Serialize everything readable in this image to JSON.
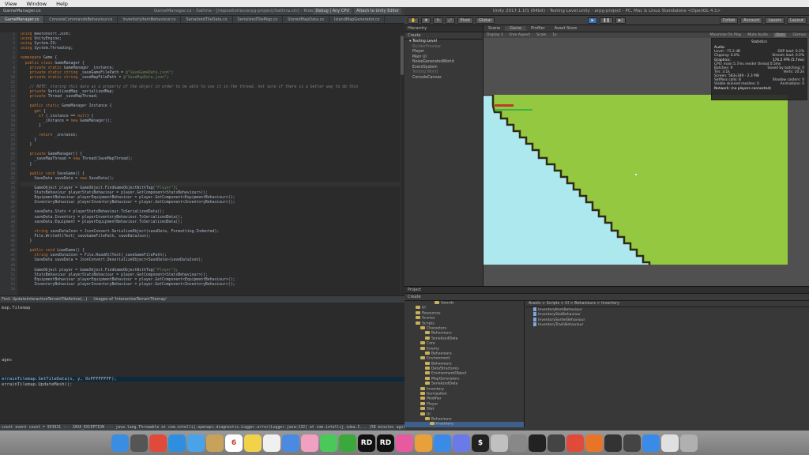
{
  "menubar": {
    "items": [
      "View",
      "Window",
      "Help"
    ]
  },
  "rider": {
    "window_title": "GameManager.cs",
    "project_title": "GameManager.cs - Xathria - [/repositories/arpg-project/Xathria.sln] - Rider 2017.2 EAP",
    "toolbar": {
      "config": "Debug | Any CPU",
      "attach": "Attach to Unity Editor"
    },
    "tabs": [
      "GameManager.cs",
      "ConsoleCommandsBehaviour.cs",
      "InventoryItemBehaviour.cs",
      "SerializedTileData.cs",
      "SerializedTileMap.cs",
      "StoredMapData.cs",
      "IslandMapGenerator.cs"
    ],
    "line_numbers": [
      "1",
      "2",
      "3",
      "4",
      "5",
      "6",
      "7",
      "8",
      "9",
      "10",
      "11",
      "12",
      "13",
      "14",
      "15",
      "16",
      "17",
      "18",
      "19",
      "20",
      "21",
      "22",
      "23",
      "24",
      "25",
      "26",
      "27",
      "28",
      "29",
      "30",
      "31",
      "32",
      "33",
      "34",
      "35",
      "36",
      "37",
      "38",
      "39",
      "40",
      "41",
      "42",
      "43",
      "44",
      "45",
      "46",
      "47",
      "48",
      "49",
      "50",
      "51",
      "52",
      "53",
      "54"
    ],
    "code": [
      "using Newtonsoft.Json;",
      "using UnityEngine;",
      "using System.IO;",
      "using System.Threading;",
      "",
      "namespace Game {",
      "  public class GameManager {",
      "    private static GameManager _instance;",
      "    private static string _saveGameFilePath = @\"SaveGameData.json\";",
      "    private static string _saveMapFilePath = @\"SaveMapData.json\";",
      "",
      "    // NOTE: storing this data as a property of the object in order to be able to use it in the thread, not sure if there is a better way to do this",
      "    private SerializedMap _serializedMap;",
      "    private Thread _saveMapThread;",
      "",
      "    public static GameManager Instance {",
      "      get {",
      "        if (_instance == null) {",
      "          _instance = new GameManager();",
      "        }",
      "",
      "        return _instance;",
      "      }",
      "    }",
      "",
      "    private GameManager() {",
      "      _saveMapThread = new Thread(SaveMapThread);",
      "    }",
      "",
      "    public void SaveGame() {",
      "      SaveData saveData = new SaveData();",
      "",
      "      GameObject player = GameObject.FindGameObjectWithTag(\"Player\");",
      "      StatsBehaviour playerStatsBehaviour = player.GetComponent<StatsBehaviour>();",
      "      EquipmentBehaviour playerEquipmentBehaviour = player.GetComponent<EquipmentBehaviour>();",
      "      InventoryBehaviour playerInventoryBehaviour = player.GetComponent<InventoryBehaviour>();",
      "",
      "      saveData.Stats = playerStatsBehaviour.ToSerializedData();",
      "      saveData.Inventory = playerInventoryBehaviour.ToSerializedData();",
      "      saveData.Equipment = playerEquipmentBehaviour.ToSerializedData();",
      "",
      "      string saveDataJson = JsonConvert.SerializeObject(saveData, Formatting.Indented);",
      "      File.WriteAllText(_saveGameFilePath, saveDataJson);",
      "    }",
      "",
      "    public void LoadGame() {",
      "      string saveDataJson = File.ReadAllText(_saveGameFilePath);",
      "      SaveData saveData = JsonConvert.DeserializeObject<SaveData>(saveDataJson);",
      "",
      "      GameObject player = GameObject.FindGameObjectWithTag(\"Player\");",
      "      StatsBehaviour playerStatsBehaviour = player.GetComponent<StatsBehaviour>();",
      "      EquipmentBehaviour playerEquipmentBehaviour = player.GetComponent<EquipmentBehaviour>();",
      "      InventoryBehaviour playerInventoryBehaviour = player.GetComponent<InventoryBehaviour>();",
      ""
    ],
    "find_bar": {
      "left": "Find: UpdateInteractiveTerrainTileActive(...)",
      "right": "Usages of 'InteractiveTerrainTilemap'"
    },
    "usages": {
      "header": "map.Tilemap",
      "group": "ages",
      "line1": "errainTilemap.SetTileData(x, y, 0xFFFFFFFF);",
      "line2": "errainTilemap.UpdateMesh();"
    },
    "status": "count event count = 953931 --- JAVA_EXCEPTION --- java.lang.Throwable at com.intellij.openapi.diagnostic.Logger.error(Logger.java:132) at com.intellij.idea.I... (58 minutes ago)    Assembly-CSharp    32:42   LF: UTF-8"
  },
  "unity": {
    "title": "Unity 2017.1.1f1 (64bit) - Testing Level.unity - arpg-project - PC, Mac & Linux Standalone <OpenGL 4.1>",
    "toolbar": {
      "pivot": "Pivot",
      "global": "Global",
      "collab": "Collab",
      "account": "Account",
      "layers": "Layers",
      "layout": "Layout"
    },
    "hierarchy": {
      "tab": "Hierarchy",
      "create": "Create",
      "scene": "Testing Level",
      "items": [
        "BuilderPreview",
        "Player",
        "Main UI",
        "NoiseGeneratedWorld",
        "EventSystem",
        "Testing World",
        "ConsoleCanvas"
      ]
    },
    "game": {
      "tabs": [
        "Scene",
        "Game",
        "Profiler",
        "Asset Store"
      ],
      "display": "Display 1",
      "aspect": "Free Aspect",
      "scale": "Scale",
      "scale_val": "1x",
      "controls": [
        "Maximize On Play",
        "Mute Audio",
        "Stats",
        "Gizmos"
      ]
    },
    "statistics": {
      "title": "Statistics",
      "audio_label": "Audio:",
      "level": "Level: -75.2 dB",
      "clipping": "Clipping: 0.0%",
      "dsp": "DSP load: 0.2%",
      "stream": "Stream load: 0.0%",
      "graphics_label": "Graphics:",
      "fps": "174.2 FPS (5.7ms)",
      "cpu": "CPU: main 5.7ms  render thread 0.5ms",
      "batches": "Batches: 9",
      "saved": "Saved by batching: 0",
      "tris": "Tris: 3.1k",
      "verts": "Verts: 10.2k",
      "screen": "Screen: 583x349 - 2.3 MB",
      "setpass": "SetPass calls: 8",
      "shadow": "Shadow casters: 0",
      "skinned": "Visible skinned meshes: 0",
      "animations": "Animations: 0",
      "network": "Network: (no players connected)"
    },
    "project": {
      "tab": "Project",
      "create": "Create",
      "breadcrumb": "Assets > Scripts > UI > Behaviours > Inventory",
      "tree": [
        "Swords",
        "UI",
        "Resources",
        "Scenes",
        "Scripts",
        "Characters",
        "Behaviours",
        "SerializedData",
        "Core",
        "Enemy",
        "Behaviours",
        "Environment",
        "Behaviours",
        "DataStructures",
        "EnvironmentObject",
        "MapGenerators",
        "SerializedData",
        "Inventory",
        "Itemization",
        "Modifier",
        "Player",
        "Stat",
        "UI",
        "Behaviours",
        "Inventory"
      ],
      "files": [
        "InventoryItemBehaviour",
        "InventorySlotBehaviour",
        "InventorySorterBehaviour",
        "InventoryTrashBehaviour"
      ]
    },
    "colors": {
      "water": "#aee8ef",
      "grass": "#93c840",
      "edge": "#2e2a14"
    }
  },
  "dock": {
    "items": [
      {
        "icon": "finder-icon",
        "color": "#3a8de0",
        "label": ""
      },
      {
        "icon": "launchpad-icon",
        "color": "#555555",
        "label": ""
      },
      {
        "icon": "chrome-icon",
        "color": "#e04a3a",
        "label": ""
      },
      {
        "icon": "safari-icon",
        "color": "#2e8fe0",
        "label": ""
      },
      {
        "icon": "mail-icon",
        "color": "#4aa3e8",
        "label": ""
      },
      {
        "icon": "notes-icon",
        "color": "#c8a25a",
        "label": ""
      },
      {
        "icon": "calendar-icon",
        "color": "#ffffff",
        "label": "6"
      },
      {
        "icon": "stickies-icon",
        "color": "#f2d24a",
        "label": ""
      },
      {
        "icon": "reminders-icon",
        "color": "#f0f0f0",
        "label": ""
      },
      {
        "icon": "keynote-icon",
        "color": "#4a8ae0",
        "label": ""
      },
      {
        "icon": "photos-icon",
        "color": "#f0a0c0",
        "label": ""
      },
      {
        "icon": "messages-icon",
        "color": "#4ac85a",
        "label": ""
      },
      {
        "icon": "facetime-icon",
        "color": "#3aa83a",
        "label": ""
      },
      {
        "icon": "rider-icon",
        "color": "#111111",
        "label": "RD"
      },
      {
        "icon": "rider-eap-icon",
        "color": "#111111",
        "label": "RD"
      },
      {
        "icon": "itunes-icon",
        "color": "#e85aa0",
        "label": ""
      },
      {
        "icon": "books-icon",
        "color": "#e8a03a",
        "label": ""
      },
      {
        "icon": "appstore-icon",
        "color": "#3a8ae8",
        "label": ""
      },
      {
        "icon": "discord-icon",
        "color": "#6a7ae8",
        "label": ""
      },
      {
        "icon": "terminal-icon",
        "color": "#222222",
        "label": "$"
      },
      {
        "icon": "preview-icon",
        "color": "#c0c0c0",
        "label": ""
      },
      {
        "icon": "settings-icon",
        "color": "#888888",
        "label": ""
      },
      {
        "icon": "unity-icon",
        "color": "#222222",
        "label": ""
      },
      {
        "icon": "unity-hub-icon",
        "color": "#444444",
        "label": ""
      },
      {
        "icon": "chrome2-icon",
        "color": "#e04a3a",
        "label": ""
      },
      {
        "icon": "firefox-icon",
        "color": "#e8742a",
        "label": ""
      },
      {
        "icon": "activity-icon",
        "color": "#333333",
        "label": ""
      },
      {
        "icon": "sublime-icon",
        "color": "#444444",
        "label": ""
      },
      {
        "icon": "appstore2-icon",
        "color": "#3a8ae8",
        "label": ""
      },
      {
        "icon": "downloads-icon",
        "color": "#e0e0e0",
        "label": ""
      },
      {
        "icon": "trash-icon",
        "color": "#b0b0b0",
        "label": ""
      }
    ]
  }
}
